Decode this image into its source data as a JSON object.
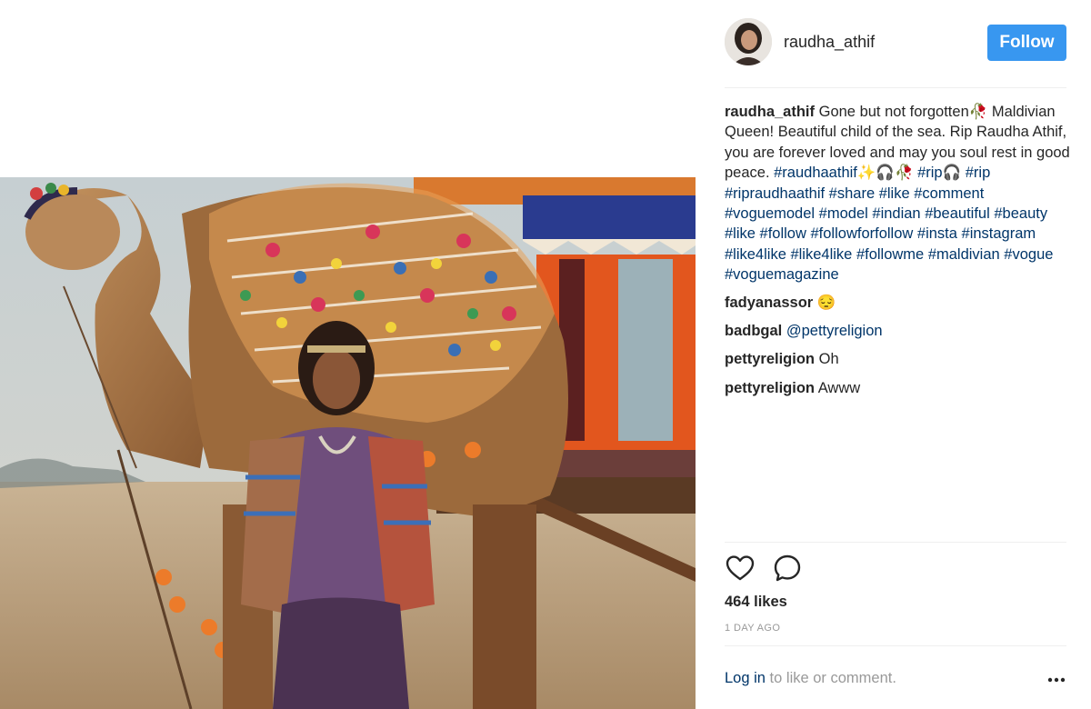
{
  "post": {
    "photo_alt": "Photo"
  },
  "header": {
    "username": "raudha_athif",
    "follow_label": "Follow"
  },
  "caption": {
    "username": "raudha_athif",
    "text": "Gone but not forgotten🥀 Maldivian Queen! Beautiful child of the sea. Rip Raudha Athif, you are forever loved and may you soul rest in good peace. ",
    "hashtags": [
      "#raudhaathif✨🎧🥀",
      "#rip🎧",
      "#rip",
      "#ripraudhaathif",
      "#share",
      "#like",
      "#comment",
      "#voguemodel",
      "#model",
      "#indian",
      "#beautiful",
      "#beauty",
      "#like",
      "#follow",
      "#followforfollow",
      "#insta",
      "#instagram",
      "#like4like",
      "#like4like",
      "#followme",
      "#maldivian",
      "#vogue",
      "#voguemagazine"
    ]
  },
  "comments": [
    {
      "username": "fadyanassor",
      "text": "😔",
      "mention": ""
    },
    {
      "username": "badbgal",
      "text": "",
      "mention": "@pettyreligion"
    },
    {
      "username": "pettyreligion",
      "text": "Oh",
      "mention": ""
    },
    {
      "username": "pettyreligion",
      "text": "Awww",
      "mention": ""
    }
  ],
  "actions": {
    "like_icon": "heart-outline-icon",
    "comment_icon": "speech-bubble-icon"
  },
  "likes": "464 likes",
  "timestamp": "1 DAY AGO",
  "footer": {
    "login_link": "Log in",
    "login_rest": " to like or comment.",
    "more_icon": "ellipsis-icon"
  },
  "colors": {
    "follow_button": "#3897f0",
    "link": "#003569",
    "muted": "#999999",
    "text": "#262626"
  }
}
